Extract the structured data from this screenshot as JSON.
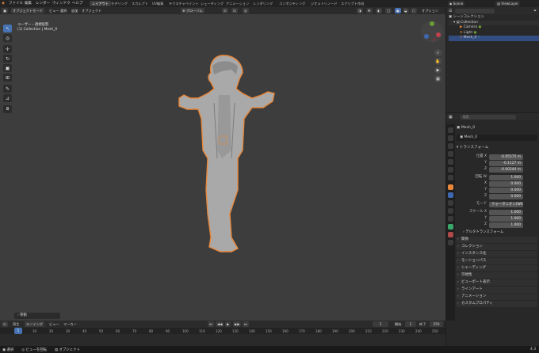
{
  "menu": {
    "file": "ファイル",
    "edit": "編集",
    "render": "レンダー",
    "window": "ウィンドウ",
    "help": "ヘルプ"
  },
  "workspaces": [
    "レイアウト",
    "モデリング",
    "スカルプト",
    "UV編集",
    "テクスチャペイント",
    "シェーディング",
    "アニメーション",
    "レンダリング",
    "コンポジティング",
    "ジオメトリノード",
    "スクリプト作成"
  ],
  "top_right": {
    "scene": "Scene",
    "view_layer": "ViewLayer"
  },
  "header": {
    "mode": "オブジェクトモード",
    "view": "ビュー",
    "select": "選択",
    "add": "追加",
    "object": "オブジェクト",
    "transform": "グローバル",
    "options": "オプション"
  },
  "viewport": {
    "view_name": "ユーザー・透視投影",
    "collection_info": "(1) Collection | Mesh_0",
    "last_op": "移動"
  },
  "outliner": {
    "root": "シーンコレクション",
    "items": [
      {
        "label": "Collection"
      },
      {
        "label": "Camera"
      },
      {
        "label": "Light"
      },
      {
        "label": "Mesh_0"
      }
    ]
  },
  "properties": {
    "search_placeholder": "検索",
    "object_name": "Mesh_0",
    "datablock": "Mesh_0",
    "transform_header": "トランスフォーム",
    "location_label": "位置 X",
    "location": [
      "-0.05575 m",
      "-0.1127 m",
      "-0.00244 m"
    ],
    "rotation_label": "回転 W",
    "rotation": [
      "1.000",
      "0.000",
      "0.000",
      "0.000"
    ],
    "mode_label": "モード",
    "mode_value": "クォータニオン(WX...",
    "scale_label": "スケール X",
    "scale": [
      "1.000",
      "1.000",
      "1.000"
    ],
    "axis": {
      "y": "Y",
      "z": "Z",
      "x": "X"
    },
    "delta": "デルタトランスフォーム",
    "panels": [
      "関係",
      "コレクション",
      "インスタンス化",
      "モーションパス",
      "シェーディング",
      "可視性",
      "ビューポート表示",
      "ラインアート",
      "アニメーション",
      "カスタムプロパティ"
    ]
  },
  "timeline": {
    "playback": "再生",
    "keying": "キーイング",
    "view": "ビュー",
    "marker": "マーカー",
    "current_frame": "1",
    "start_label": "開始",
    "start": "1",
    "end_label": "終了",
    "end": "250",
    "ticks": [
      "0",
      "10",
      "20",
      "30",
      "40",
      "50",
      "60",
      "70",
      "80",
      "90",
      "100",
      "110",
      "120",
      "130",
      "140",
      "150",
      "160",
      "170",
      "180",
      "190",
      "200",
      "210",
      "220",
      "230",
      "240",
      "250"
    ]
  },
  "status": {
    "select": "選択",
    "rotate": "ビューを回転",
    "options": "オブジェクト",
    "version": "4.3"
  },
  "colors": {
    "accent": "#4772b3",
    "selection": "#e8873a",
    "active_workspace": "#3f3f3f"
  }
}
